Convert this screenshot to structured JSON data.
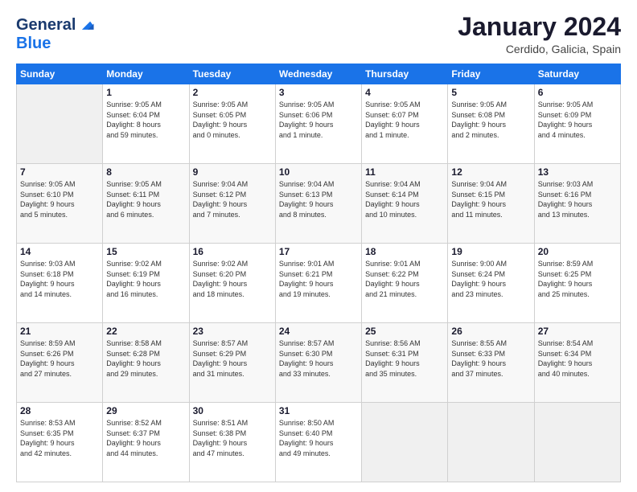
{
  "header": {
    "logo_line1": "General",
    "logo_line2": "Blue",
    "month_title": "January 2024",
    "location": "Cerdido, Galicia, Spain"
  },
  "weekdays": [
    "Sunday",
    "Monday",
    "Tuesday",
    "Wednesday",
    "Thursday",
    "Friday",
    "Saturday"
  ],
  "weeks": [
    [
      {
        "day": "",
        "info": ""
      },
      {
        "day": "1",
        "info": "Sunrise: 9:05 AM\nSunset: 6:04 PM\nDaylight: 8 hours\nand 59 minutes."
      },
      {
        "day": "2",
        "info": "Sunrise: 9:05 AM\nSunset: 6:05 PM\nDaylight: 9 hours\nand 0 minutes."
      },
      {
        "day": "3",
        "info": "Sunrise: 9:05 AM\nSunset: 6:06 PM\nDaylight: 9 hours\nand 1 minute."
      },
      {
        "day": "4",
        "info": "Sunrise: 9:05 AM\nSunset: 6:07 PM\nDaylight: 9 hours\nand 1 minute."
      },
      {
        "day": "5",
        "info": "Sunrise: 9:05 AM\nSunset: 6:08 PM\nDaylight: 9 hours\nand 2 minutes."
      },
      {
        "day": "6",
        "info": "Sunrise: 9:05 AM\nSunset: 6:09 PM\nDaylight: 9 hours\nand 4 minutes."
      }
    ],
    [
      {
        "day": "7",
        "info": "Sunrise: 9:05 AM\nSunset: 6:10 PM\nDaylight: 9 hours\nand 5 minutes."
      },
      {
        "day": "8",
        "info": "Sunrise: 9:05 AM\nSunset: 6:11 PM\nDaylight: 9 hours\nand 6 minutes."
      },
      {
        "day": "9",
        "info": "Sunrise: 9:04 AM\nSunset: 6:12 PM\nDaylight: 9 hours\nand 7 minutes."
      },
      {
        "day": "10",
        "info": "Sunrise: 9:04 AM\nSunset: 6:13 PM\nDaylight: 9 hours\nand 8 minutes."
      },
      {
        "day": "11",
        "info": "Sunrise: 9:04 AM\nSunset: 6:14 PM\nDaylight: 9 hours\nand 10 minutes."
      },
      {
        "day": "12",
        "info": "Sunrise: 9:04 AM\nSunset: 6:15 PM\nDaylight: 9 hours\nand 11 minutes."
      },
      {
        "day": "13",
        "info": "Sunrise: 9:03 AM\nSunset: 6:16 PM\nDaylight: 9 hours\nand 13 minutes."
      }
    ],
    [
      {
        "day": "14",
        "info": "Sunrise: 9:03 AM\nSunset: 6:18 PM\nDaylight: 9 hours\nand 14 minutes."
      },
      {
        "day": "15",
        "info": "Sunrise: 9:02 AM\nSunset: 6:19 PM\nDaylight: 9 hours\nand 16 minutes."
      },
      {
        "day": "16",
        "info": "Sunrise: 9:02 AM\nSunset: 6:20 PM\nDaylight: 9 hours\nand 18 minutes."
      },
      {
        "day": "17",
        "info": "Sunrise: 9:01 AM\nSunset: 6:21 PM\nDaylight: 9 hours\nand 19 minutes."
      },
      {
        "day": "18",
        "info": "Sunrise: 9:01 AM\nSunset: 6:22 PM\nDaylight: 9 hours\nand 21 minutes."
      },
      {
        "day": "19",
        "info": "Sunrise: 9:00 AM\nSunset: 6:24 PM\nDaylight: 9 hours\nand 23 minutes."
      },
      {
        "day": "20",
        "info": "Sunrise: 8:59 AM\nSunset: 6:25 PM\nDaylight: 9 hours\nand 25 minutes."
      }
    ],
    [
      {
        "day": "21",
        "info": "Sunrise: 8:59 AM\nSunset: 6:26 PM\nDaylight: 9 hours\nand 27 minutes."
      },
      {
        "day": "22",
        "info": "Sunrise: 8:58 AM\nSunset: 6:28 PM\nDaylight: 9 hours\nand 29 minutes."
      },
      {
        "day": "23",
        "info": "Sunrise: 8:57 AM\nSunset: 6:29 PM\nDaylight: 9 hours\nand 31 minutes."
      },
      {
        "day": "24",
        "info": "Sunrise: 8:57 AM\nSunset: 6:30 PM\nDaylight: 9 hours\nand 33 minutes."
      },
      {
        "day": "25",
        "info": "Sunrise: 8:56 AM\nSunset: 6:31 PM\nDaylight: 9 hours\nand 35 minutes."
      },
      {
        "day": "26",
        "info": "Sunrise: 8:55 AM\nSunset: 6:33 PM\nDaylight: 9 hours\nand 37 minutes."
      },
      {
        "day": "27",
        "info": "Sunrise: 8:54 AM\nSunset: 6:34 PM\nDaylight: 9 hours\nand 40 minutes."
      }
    ],
    [
      {
        "day": "28",
        "info": "Sunrise: 8:53 AM\nSunset: 6:35 PM\nDaylight: 9 hours\nand 42 minutes."
      },
      {
        "day": "29",
        "info": "Sunrise: 8:52 AM\nSunset: 6:37 PM\nDaylight: 9 hours\nand 44 minutes."
      },
      {
        "day": "30",
        "info": "Sunrise: 8:51 AM\nSunset: 6:38 PM\nDaylight: 9 hours\nand 47 minutes."
      },
      {
        "day": "31",
        "info": "Sunrise: 8:50 AM\nSunset: 6:40 PM\nDaylight: 9 hours\nand 49 minutes."
      },
      {
        "day": "",
        "info": ""
      },
      {
        "day": "",
        "info": ""
      },
      {
        "day": "",
        "info": ""
      }
    ]
  ]
}
